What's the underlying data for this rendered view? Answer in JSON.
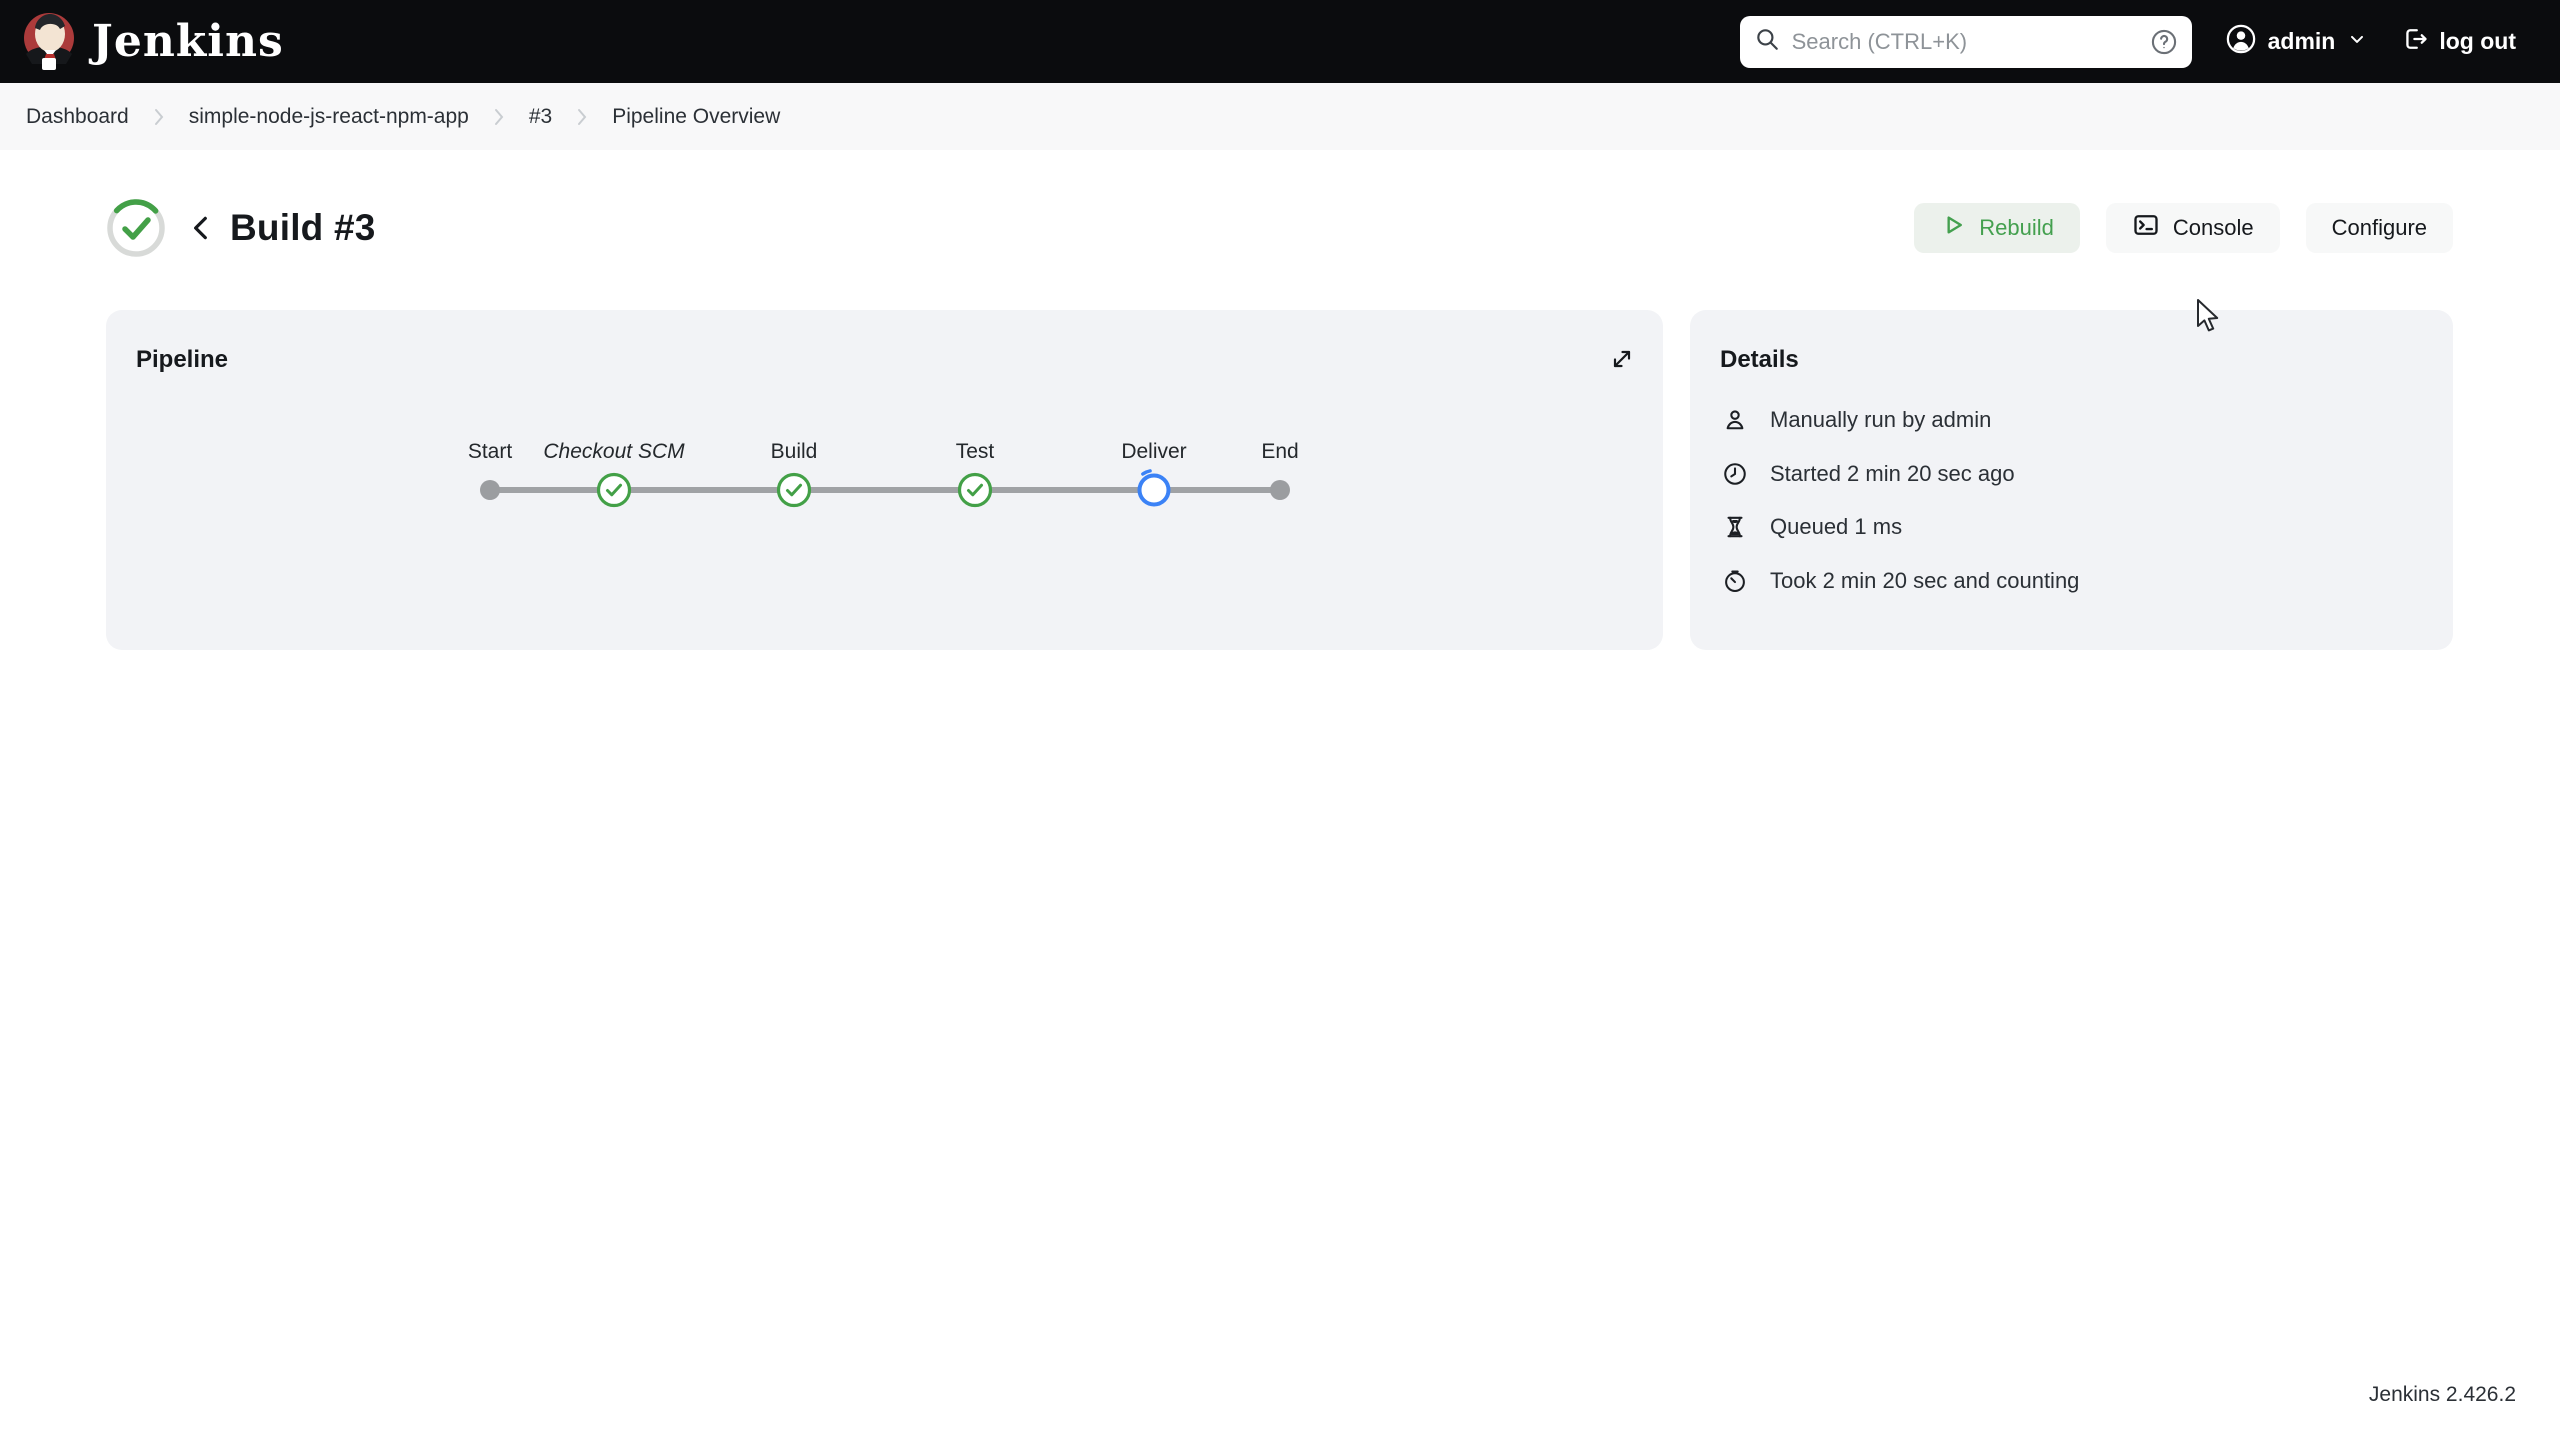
{
  "header": {
    "brand": "Jenkins",
    "search": {
      "placeholder": "Search (CTRL+K)"
    },
    "user": "admin",
    "logout_label": "log out"
  },
  "breadcrumb": {
    "items": [
      "Dashboard",
      "simple-node-js-react-npm-app",
      "#3",
      "Pipeline Overview"
    ]
  },
  "page": {
    "title": "Build #3",
    "actions": [
      {
        "label": "Rebuild"
      },
      {
        "label": "Console"
      },
      {
        "label": "Configure"
      }
    ]
  },
  "pipeline": {
    "title": "Pipeline",
    "stages": [
      {
        "label": "Start",
        "status": "terminal"
      },
      {
        "label": "Checkout SCM",
        "status": "success"
      },
      {
        "label": "Build",
        "status": "success"
      },
      {
        "label": "Test",
        "status": "success"
      },
      {
        "label": "Deliver",
        "status": "running"
      },
      {
        "label": "End",
        "status": "terminal"
      }
    ]
  },
  "details": {
    "title": "Details",
    "rows": [
      {
        "icon": "user-icon",
        "text": "Manually run by admin"
      },
      {
        "icon": "clock-icon",
        "text": "Started 2 min 20 sec ago"
      },
      {
        "icon": "hourglass-icon",
        "text": "Queued 1 ms"
      },
      {
        "icon": "stopwatch-icon",
        "text": "Took 2 min 20 sec and counting"
      }
    ]
  },
  "footer": {
    "version": "Jenkins 2.426.2"
  },
  "colors": {
    "green": "#43a047",
    "blue": "#3b82f6",
    "header_bg": "#0b0c0e",
    "card_bg": "#f2f3f6",
    "rebuild_bg": "#ecf1ec"
  }
}
